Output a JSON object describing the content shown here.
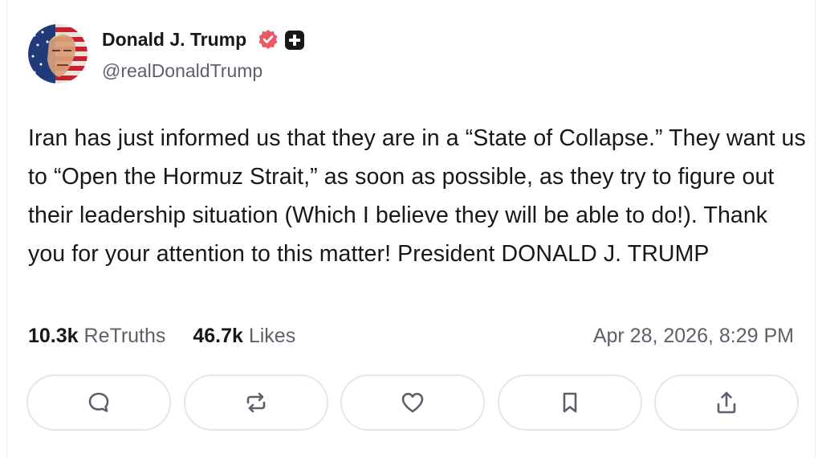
{
  "post": {
    "author_name": "Donald J. Trump",
    "handle": "@realDonaldTrump",
    "text": "Iran has just informed us that they are in a “State of Collapse.” They want us to “Open the Hormuz Strait,” as soon as possible, as they try to figure out their leadership situation (Which I believe they will be able to do!). Thank you for your attention to this matter! President DONALD J. TRUMP",
    "retruths_count": "10.3k",
    "retruths_label": "ReTruths",
    "likes_count": "46.7k",
    "likes_label": "Likes",
    "timestamp": "Apr 28, 2026, 8:29 PM"
  },
  "badges": {
    "verified_icon": "verified-badge-icon",
    "verified_color": "#e85a66",
    "plus_icon": "plus-badge-icon"
  },
  "actions": [
    {
      "icon": "reply-icon"
    },
    {
      "icon": "retruth-icon"
    },
    {
      "icon": "like-icon"
    },
    {
      "icon": "bookmark-icon"
    },
    {
      "icon": "share-icon"
    }
  ],
  "colors": {
    "text_primary": "#17171c",
    "text_secondary": "#5f5f6b",
    "button_border": "#e6e6ea"
  }
}
